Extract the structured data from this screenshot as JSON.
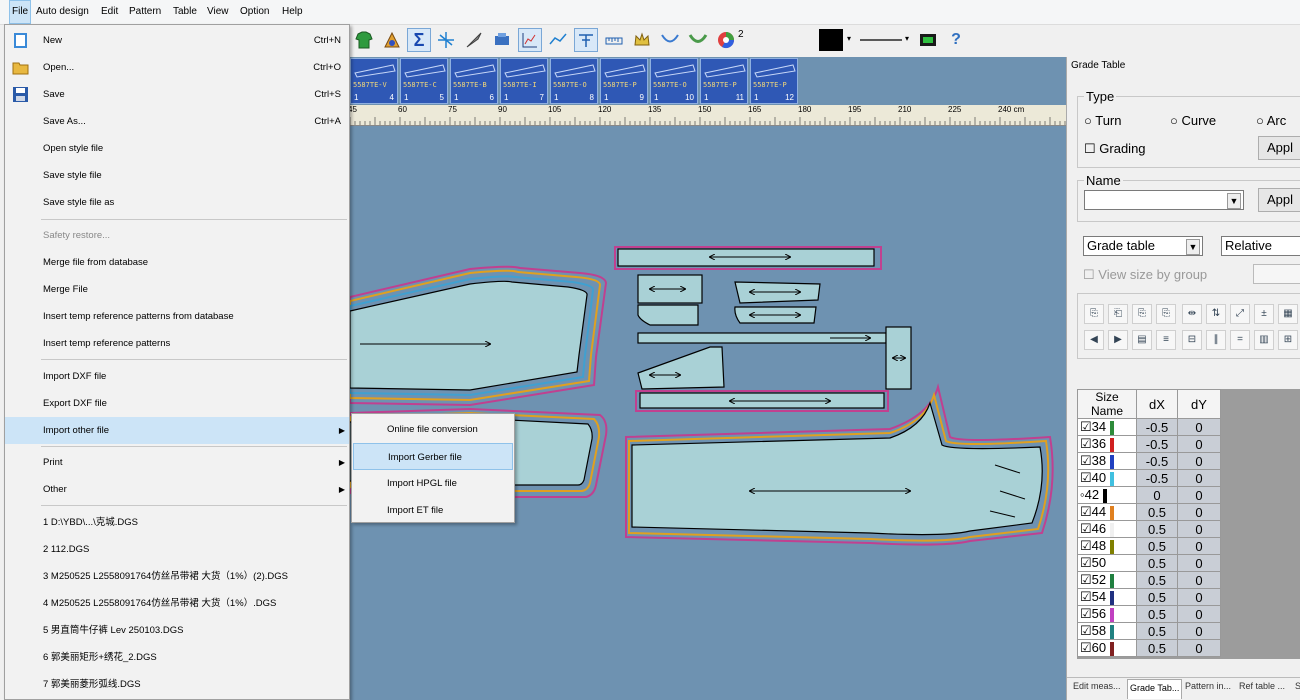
{
  "menubar": {
    "items": [
      "File",
      "Auto design",
      "Edit",
      "Pattern",
      "Table",
      "View",
      "Option",
      "Help"
    ]
  },
  "toolbar": {
    "line_width_value": "2",
    "icons": [
      "shirt-icon",
      "palette-icon",
      "sigma-icon",
      "grade-rule-icon",
      "brush-icon",
      "measure-icon",
      "chart-icon",
      "line-chart-icon",
      "tool-icon",
      "ruler-icon",
      "crown-icon",
      "curve-icon",
      "shape-icon",
      "color-wheel-icon",
      "color-swatch-icon",
      "line-style-icon",
      "film-icon",
      "help-icon"
    ]
  },
  "thumbnails": [
    {
      "code": "5587TE-V",
      "index": "1",
      "number": "4"
    },
    {
      "code": "5587TE-C",
      "index": "1",
      "number": "5"
    },
    {
      "code": "5587TE-B",
      "index": "1",
      "number": "6"
    },
    {
      "code": "5587TE-I",
      "index": "1",
      "number": "7"
    },
    {
      "code": "5587TE-O",
      "index": "1",
      "number": "8"
    },
    {
      "code": "5587TE-P",
      "index": "1",
      "number": "9"
    },
    {
      "code": "5587TE-O",
      "index": "1",
      "number": "10"
    },
    {
      "code": "5587TE-P",
      "index": "1",
      "number": "11"
    },
    {
      "code": "5587TE-P",
      "index": "1",
      "number": "12"
    }
  ],
  "ruler": {
    "ticks": [
      "45",
      "60",
      "75",
      "90",
      "105",
      "120",
      "135",
      "150",
      "165",
      "180",
      "195",
      "210",
      "225",
      "240 cm"
    ]
  },
  "file_menu": {
    "items": [
      {
        "label": "New",
        "shortcut": "Ctrl+N"
      },
      {
        "label": "Open...",
        "shortcut": "Ctrl+O"
      },
      {
        "label": "Save",
        "shortcut": "Ctrl+S"
      },
      {
        "label": "Save As...",
        "shortcut": "Ctrl+A"
      },
      {
        "label": "Open style file",
        "shortcut": ""
      },
      {
        "label": "Save style file",
        "shortcut": ""
      },
      {
        "label": "Save style file as",
        "shortcut": ""
      },
      {
        "label": "Safety restore...",
        "shortcut": ""
      },
      {
        "label": "Merge file from database",
        "shortcut": ""
      },
      {
        "label": "Merge File",
        "shortcut": ""
      },
      {
        "label": "Insert temp reference patterns from database",
        "shortcut": ""
      },
      {
        "label": "Insert temp reference patterns",
        "shortcut": ""
      },
      {
        "label": "Import DXF file",
        "shortcut": ""
      },
      {
        "label": "Export DXF file",
        "shortcut": ""
      },
      {
        "label": "Import other file",
        "shortcut": ""
      },
      {
        "label": "Print",
        "shortcut": ""
      },
      {
        "label": "Other",
        "shortcut": ""
      }
    ],
    "recent_files": [
      "1 D:\\YBD\\...\\克城.DGS",
      "2 112.DGS",
      "3 M250525   L2558091764仿丝吊带裙   大货（1%）(2).DGS",
      "4 M250525   L2558091764仿丝吊带裙   大货（1%）.DGS",
      "5 男直筒牛仔裤 Lev 250103.DGS",
      "6 郭美丽矩形+绣花_2.DGS",
      "7 郭美丽菱形弧线.DGS"
    ]
  },
  "import_submenu": {
    "items": [
      "Online file conversion",
      "Import Gerber file",
      "Import HPGL file",
      "Import ET file"
    ],
    "highlighted": "Import Gerber file"
  },
  "grade_panel": {
    "title": "Grade Table",
    "type_group": {
      "title": "Type",
      "options": [
        "Turn",
        "Curve",
        "Arc"
      ],
      "grading_label": "Grading",
      "apply_label": "Appl"
    },
    "name_group": {
      "title": "Name",
      "value": "",
      "apply_label": "Appl"
    },
    "table_select": "Grade table",
    "mode_select": "Relative",
    "view_by_group_label": "View size by group",
    "columns": [
      "Size Name",
      "dX",
      "dY"
    ],
    "rows": [
      {
        "size": "34",
        "dx": "-0.5",
        "dy": "0",
        "color": "#2e8b3a",
        "mark": "☑"
      },
      {
        "size": "36",
        "dx": "-0.5",
        "dy": "0",
        "color": "#d02020",
        "mark": "☑"
      },
      {
        "size": "38",
        "dx": "-0.5",
        "dy": "0",
        "color": "#2040c0",
        "mark": "☑"
      },
      {
        "size": "40",
        "dx": "-0.5",
        "dy": "0",
        "color": "#40c0e0",
        "mark": "☑"
      },
      {
        "size": "42",
        "dx": "0",
        "dy": "0",
        "color": "#000000",
        "mark": "◦"
      },
      {
        "size": "44",
        "dx": "0.5",
        "dy": "0",
        "color": "#e08020",
        "mark": "☑"
      },
      {
        "size": "46",
        "dx": "0.5",
        "dy": "0",
        "color": "#f0f0f0",
        "mark": "☑"
      },
      {
        "size": "48",
        "dx": "0.5",
        "dy": "0",
        "color": "#808000",
        "mark": "☑"
      },
      {
        "size": "50",
        "dx": "0.5",
        "dy": "0",
        "color": "#ffffff",
        "mark": "☑"
      },
      {
        "size": "52",
        "dx": "0.5",
        "dy": "0",
        "color": "#208040",
        "mark": "☑"
      },
      {
        "size": "54",
        "dx": "0.5",
        "dy": "0",
        "color": "#203080",
        "mark": "☑"
      },
      {
        "size": "56",
        "dx": "0.5",
        "dy": "0",
        "color": "#c040c0",
        "mark": "☑"
      },
      {
        "size": "58",
        "dx": "0.5",
        "dy": "0",
        "color": "#208080",
        "mark": "☑"
      },
      {
        "size": "60",
        "dx": "0.5",
        "dy": "0",
        "color": "#802020",
        "mark": "☑"
      }
    ],
    "bottom_tabs": [
      "Edit meas...",
      "Grade Tab...",
      "Pattern in...",
      "Ref table ...",
      "S"
    ]
  },
  "colors": {
    "canvas_bg": "#6e92b1",
    "piece_fill": "#a9d1d6",
    "highlight": "#cce4f7"
  }
}
